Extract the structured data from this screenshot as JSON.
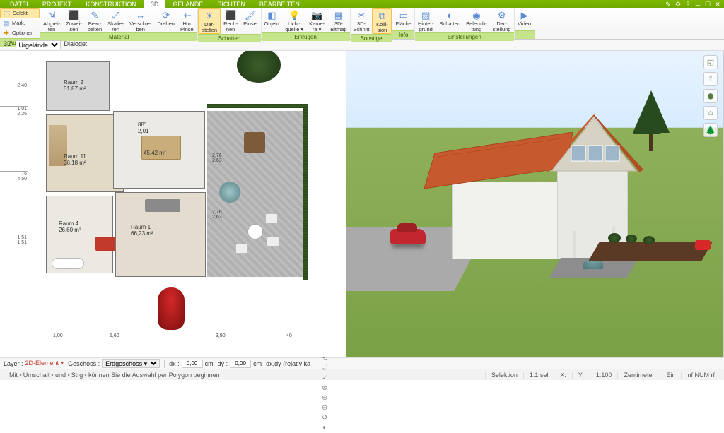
{
  "menu": {
    "tabs": [
      "DATEI",
      "PROJEKT",
      "KONSTRUKTION",
      "3D",
      "GELÄNDE",
      "SICHTEN",
      "BEARBEITEN"
    ],
    "active_index": 3
  },
  "ribbon": {
    "groups": [
      {
        "label": "Auswahl",
        "items": [
          {
            "icon": "⬚",
            "label": "Selekt",
            "small": true,
            "highlight": true
          },
          {
            "icon": "▤",
            "label": "Mark.",
            "small": true
          },
          {
            "icon": "✚",
            "label": "Optionen",
            "small": true,
            "accent": "#d88a00"
          }
        ],
        "stacked": true
      },
      {
        "label": "Material",
        "items": [
          {
            "icon": "⇲",
            "label": "Abgrei-\nfen"
          },
          {
            "icon": "⬛",
            "label": "Zuwei-\nsen"
          },
          {
            "icon": "✎",
            "label": "Bear-\nbeiten"
          },
          {
            "icon": "⤢",
            "label": "Skalie-\nren"
          },
          {
            "icon": "↔",
            "label": "Verschie-\nben"
          },
          {
            "icon": "⟳",
            "label": "Drehen"
          },
          {
            "icon": "⇠",
            "label": "Hin.\nPinsel"
          }
        ]
      },
      {
        "label": "Schatten",
        "items": [
          {
            "icon": "☀",
            "label": "Dar-\nstellen",
            "highlight": true
          },
          {
            "icon": "⬛",
            "label": "Rech-\nnen"
          },
          {
            "icon": "🖌",
            "label": "Pinsel"
          }
        ]
      },
      {
        "label": "Einfügen",
        "items": [
          {
            "icon": "◧",
            "label": "Objekt"
          },
          {
            "icon": "💡",
            "label": "Licht-\nquelle ▾"
          },
          {
            "icon": "📷",
            "label": "Kame-\nra ▾"
          },
          {
            "icon": "▦",
            "label": "3D-\nBitmap"
          }
        ]
      },
      {
        "label": "Sonstige",
        "items": [
          {
            "icon": "✂",
            "label": "3D-\nSchnitt"
          },
          {
            "icon": "⧉",
            "label": "Kolli-\nsion",
            "highlight": true
          }
        ]
      },
      {
        "label": "Info",
        "items": [
          {
            "icon": "▭",
            "label": "Fläche"
          }
        ]
      },
      {
        "label": "Einstellungen",
        "items": [
          {
            "icon": "▧",
            "label": "Hinter-\ngrund"
          },
          {
            "icon": "◐",
            "label": "Schatten"
          },
          {
            "icon": "◉",
            "label": "Beleuch-\ntung"
          },
          {
            "icon": "⚙",
            "label": "Dar-\nstellung"
          }
        ]
      },
      {
        "label": "",
        "items": [
          {
            "icon": "▶",
            "label": "Video"
          }
        ]
      }
    ]
  },
  "subbar": {
    "mode_label": "3D",
    "mode_value": "Urgelände",
    "dialog_label": "Dialoge:"
  },
  "plan": {
    "rooms": [
      {
        "name": "Raum 2",
        "area": "31,87 m²"
      },
      {
        "name": "Raum 11",
        "area": "36,18 m²"
      },
      {
        "name": "",
        "area": "45,42 m²",
        "extra": "88°\n2,01"
      },
      {
        "name": "Raum 4",
        "area": "26,60 m²"
      },
      {
        "name": "Raum 1",
        "area": "66,23 m²"
      }
    ],
    "dims_left": [
      "2,40",
      "1,01\n2,26",
      "76\n4,50",
      "1,51\n1,51"
    ],
    "dims_right": [
      "2,76\n2,63",
      "2,76\n2,63"
    ],
    "dims_bottom": [
      "1,00",
      "5,60",
      "3,90",
      "40"
    ]
  },
  "viewtools": [
    "◱",
    "⟟",
    "⬢",
    "⌂",
    "🌲"
  ],
  "bottombar": {
    "layer_label": "Layer :",
    "layer_value": "2D-Element ▾",
    "geschoss_label": "Geschoss :",
    "geschoss_value": "Erdgeschoss ▾",
    "dx_label": "dx :",
    "dx_value": "0,00",
    "unit": "cm",
    "dy_label": "dy :",
    "dy_value": "0,00",
    "mode_label": "dx,dy (relativ ka",
    "tool_icons": [
      "⊞",
      "⊡",
      "◯",
      "⬚",
      "⬛",
      "✎",
      "⟲",
      "⤾",
      "✓",
      "⊗",
      "⊕",
      "⊖",
      "↺",
      "|",
      "◐",
      "|"
    ]
  },
  "status": {
    "hint": "Mit <Umschalt> und <Strg>  können Sie die Auswahl per Polygon beginnen",
    "selektion": "Selektion",
    "ratio": "1:1 sel",
    "x": "X:",
    "y": "Y:",
    "scale": "1:100",
    "unit": "Zentimeter",
    "ein": "Ein",
    "num": "nf NUM rf"
  }
}
